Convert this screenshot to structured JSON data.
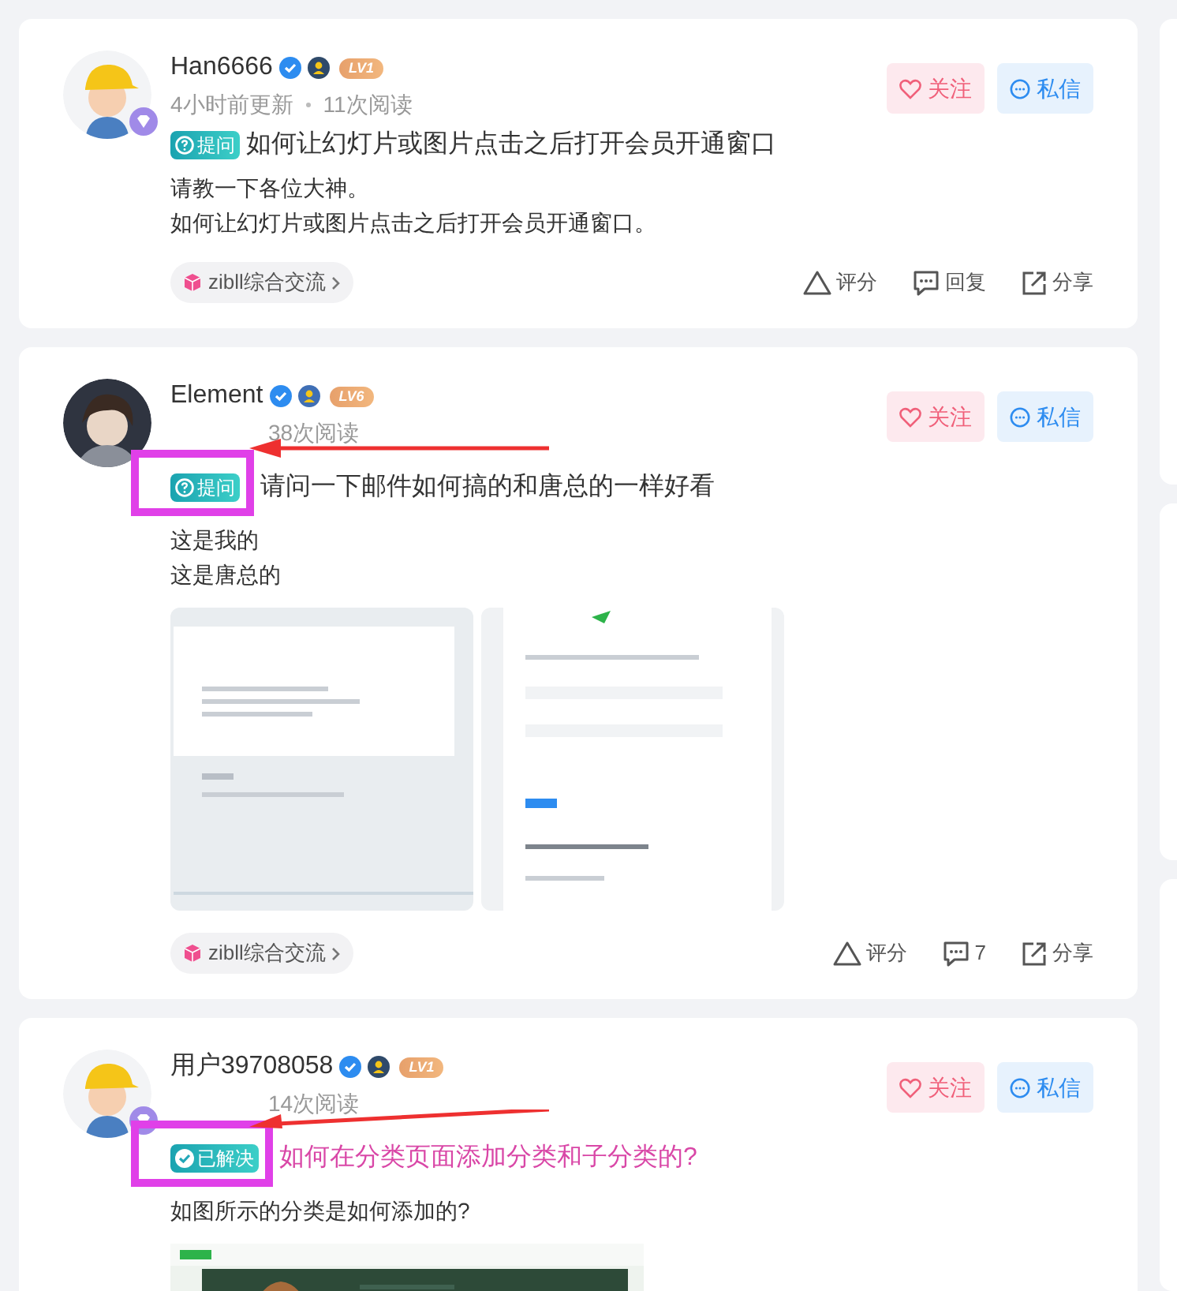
{
  "posts": [
    {
      "author": "Han6666",
      "avatar": {
        "kind": "cap"
      },
      "vip": true,
      "level": "LV1",
      "meta": [
        "4小时前更新",
        "11次阅读"
      ],
      "follow": "关注",
      "message": "私信",
      "tag": {
        "kind": "question",
        "label": "提问",
        "highlighted": false
      },
      "title": "如何让幻灯片或图片点击之后打开会员开通窗口",
      "title_highlighted": false,
      "body": [
        "请教一下各位大神。",
        "如何让幻灯片或图片点击之后打开会员开通窗口。"
      ],
      "topic": "zibll综合交流",
      "actions": [
        {
          "kind": "rate",
          "label": "评分"
        },
        {
          "kind": "comment",
          "label": "回复"
        },
        {
          "kind": "share",
          "label": "分享"
        }
      ]
    },
    {
      "author": "Element",
      "avatar": {
        "kind": "dark"
      },
      "vip": false,
      "level": "LV6",
      "meta": [
        "38次阅读"
      ],
      "follow": "关注",
      "message": "私信",
      "tag": {
        "kind": "question",
        "label": "提问",
        "highlighted": true
      },
      "title": "请问一下邮件如何搞的和唐总的一样好看",
      "title_highlighted": false,
      "body": [
        "这是我的",
        "这是唐总的"
      ],
      "images": [
        {
          "kind": "picture"
        },
        {
          "kind": "picture"
        }
      ],
      "topic": "zibll综合交流",
      "actions": [
        {
          "kind": "rate",
          "label": "评分"
        },
        {
          "kind": "comment",
          "label": "7"
        },
        {
          "kind": "share",
          "label": "分享"
        }
      ]
    },
    {
      "author": "用户39708058",
      "avatar": {
        "kind": "cap"
      },
      "vip": true,
      "level": "LV1",
      "meta": [
        "14次阅读"
      ],
      "follow": "关注",
      "message": "私信",
      "tag": {
        "kind": "solved",
        "label": "已解决",
        "highlighted": true
      },
      "title": "如何在分类页面添加分类和子分类的?",
      "title_highlighted": true,
      "body": [
        "如图所示的分类是如何添加的?"
      ],
      "images": [
        {
          "kind": "picture"
        }
      ]
    }
  ]
}
